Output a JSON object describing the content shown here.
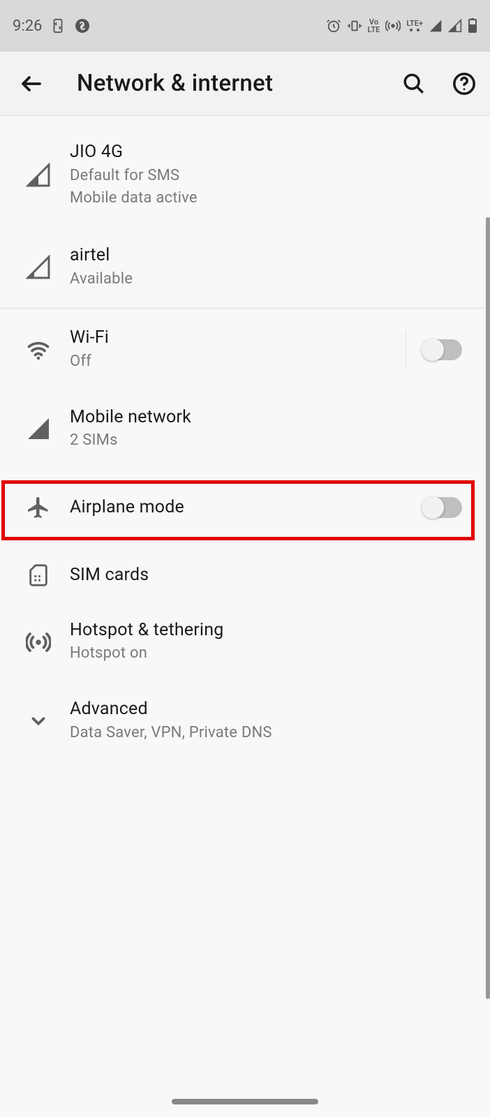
{
  "status": {
    "time": "9:26",
    "volte": "Vo\nLTE",
    "lte": "LTE+"
  },
  "header": {
    "title": "Network & internet"
  },
  "items": {
    "sim1": {
      "title": "JIO 4G",
      "sub1": "Default for SMS",
      "sub2": "Mobile data active"
    },
    "sim2": {
      "title": "airtel",
      "sub": "Available"
    },
    "wifi": {
      "title": "Wi-Fi",
      "sub": "Off"
    },
    "mobile": {
      "title": "Mobile network",
      "sub": "2 SIMs"
    },
    "airplane": {
      "title": "Airplane mode"
    },
    "simcards": {
      "title": "SIM cards"
    },
    "hotspot": {
      "title": "Hotspot & tethering",
      "sub": "Hotspot on"
    },
    "advanced": {
      "title": "Advanced",
      "sub": "Data Saver, VPN, Private DNS"
    }
  }
}
